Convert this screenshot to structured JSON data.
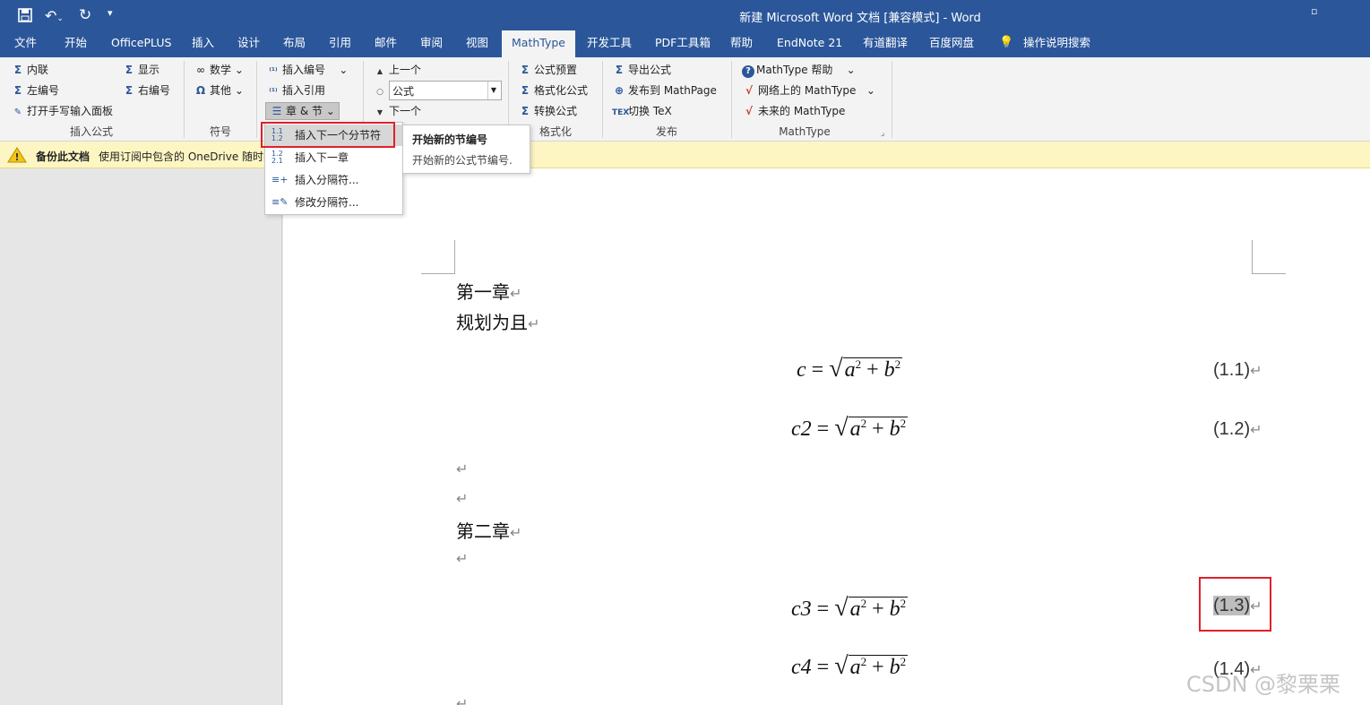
{
  "window": {
    "title": "新建 Microsoft Word 文档 [兼容模式]  -  Word"
  },
  "quick_access": {
    "save_icon": "save-icon",
    "undo_icon": "undo-icon",
    "redo_icon": "redo-icon",
    "customize_icon": "customize-icon"
  },
  "tabs": [
    "文件",
    "开始",
    "OfficePLUS",
    "插入",
    "设计",
    "布局",
    "引用",
    "邮件",
    "审阅",
    "视图",
    "MathType",
    "开发工具",
    "PDF工具箱",
    "帮助",
    "EndNote 21",
    "有道翻译",
    "百度网盘",
    "操作说明搜索"
  ],
  "active_tab": "MathType",
  "ribbon": {
    "insert_formula": {
      "label": "插入公式",
      "inline": "内联",
      "display": "显示",
      "left_num": "左编号",
      "right_num": "右编号",
      "handwrite": "打开手写输入面板"
    },
    "symbols": {
      "label": "符号",
      "math": "数学",
      "other": "其他"
    },
    "numbering": {
      "insert_number": "插入编号",
      "insert_ref": "插入引用",
      "chapter_section": "章 & 节"
    },
    "browse": {
      "prev": "上一个",
      "dropdown_value": "公式",
      "next": "下一个"
    },
    "format": {
      "label": "格式化",
      "preset": "公式预置",
      "format": "格式化公式",
      "convert": "转换公式"
    },
    "publish": {
      "label": "发布",
      "export": "导出公式",
      "publish": "发布到 MathPage",
      "toggle_tex": "切换 TeX"
    },
    "mathtype": {
      "label": "MathType",
      "help": "MathType 帮助",
      "online": "网络上的 MathType",
      "future": "未来的 MathType"
    }
  },
  "infobar": {
    "title": "备份此文档",
    "message": "使用订阅中包含的 OneDrive 随时随地访问和保存文档"
  },
  "dropdown": {
    "items": [
      "插入下一个分节符",
      "插入下一章",
      "插入分隔符...",
      "修改分隔符..."
    ],
    "icons": [
      "1.1\n1.2",
      "1.2\n2.1",
      "≡+",
      "≡✎"
    ]
  },
  "tooltip": {
    "title": "开始新的节编号",
    "desc": "开始新的公式节编号."
  },
  "document": {
    "heading1": "第一章",
    "line2": "规划为且",
    "heading2": "第二章",
    "equations": [
      {
        "lhs": "c",
        "num": "(1.1)"
      },
      {
        "lhs": "c2",
        "num": "(1.2)"
      },
      {
        "lhs": "c3",
        "num": "(1.3)"
      },
      {
        "lhs": "c4",
        "num": "(1.4)"
      }
    ],
    "radicand_a": "a",
    "radicand_b": "b",
    "sup": "2",
    "plus": "+",
    "eq_sign": "=",
    "para_mark": "↵"
  },
  "watermark": "CSDN @黎栗栗",
  "colors": {
    "brand": "#2b579a",
    "highlight_box": "#e0202a",
    "infobar": "#fdf6c3"
  }
}
